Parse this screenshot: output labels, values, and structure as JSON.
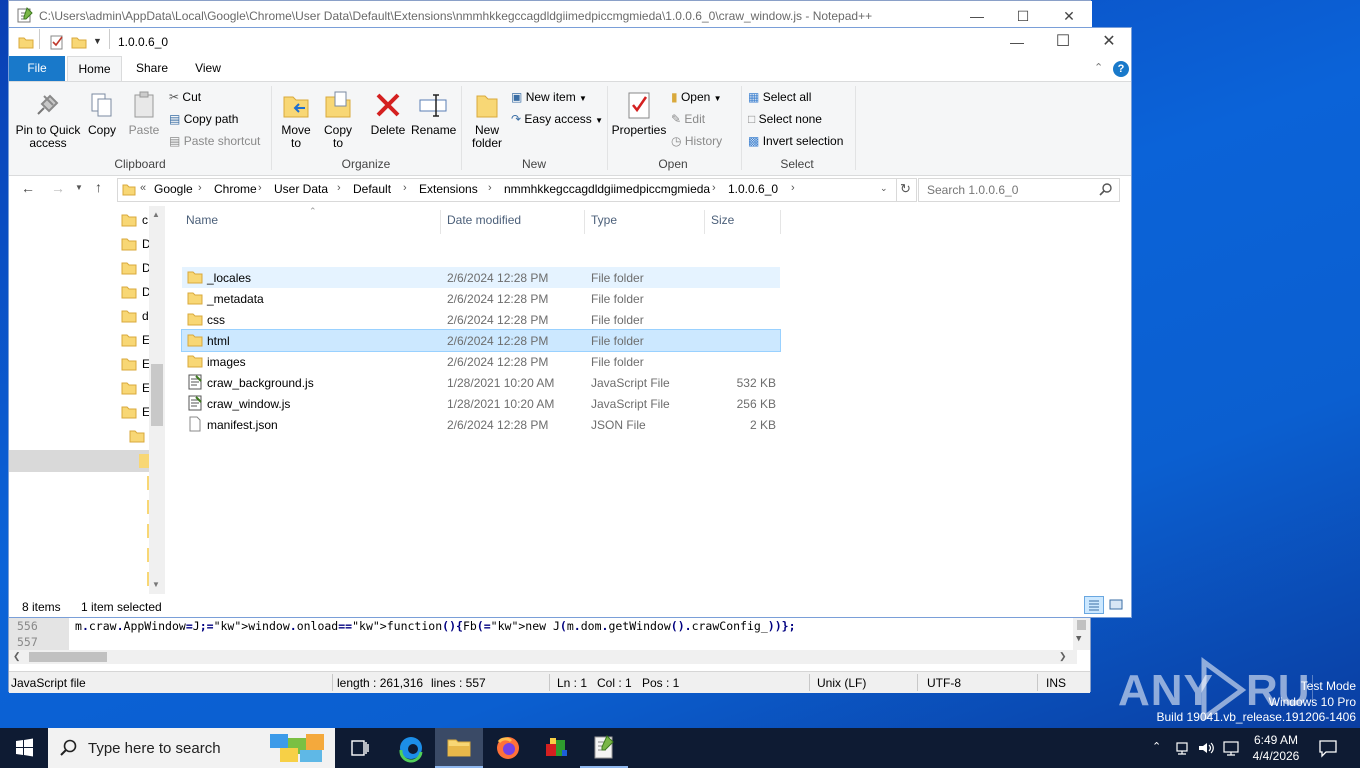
{
  "notepad": {
    "title": "C:\\Users\\admin\\AppData\\Local\\Google\\Chrome\\User Data\\Default\\Extensions\\nmmhkkegccagdldgiimedpiccmgmieda\\1.0.0.6_0\\craw_window.js - Notepad++",
    "line_numbers": [
      "556",
      "557"
    ],
    "code_line": "m.craw.AppWindow=J;window.onload=function(){Fb(new J(m.dom.getWindow().crawConfig_))};",
    "status": {
      "filetype": "JavaScript file",
      "length": "length : 261,316",
      "lines": "lines : 557",
      "ln": "Ln : 1",
      "col": "Col : 1",
      "pos": "Pos : 1",
      "eol": "Unix (LF)",
      "encoding": "UTF-8",
      "mode": "INS"
    }
  },
  "explorer": {
    "title_path": "1.0.0.6_0",
    "tabs": [
      "File",
      "Home",
      "Share",
      "View"
    ],
    "ribbon": {
      "clipboard": {
        "pin": "Pin to Quick access",
        "copy": "Copy",
        "paste": "Paste",
        "cut": "Cut",
        "copy_path": "Copy path",
        "paste_shortcut": "Paste shortcut",
        "label": "Clipboard"
      },
      "organize": {
        "move_to": "Move to",
        "copy_to": "Copy to",
        "delete": "Delete",
        "rename": "Rename",
        "label": "Organize"
      },
      "new": {
        "new_folder": "New folder",
        "new_item": "New item",
        "easy_access": "Easy access",
        "label": "New"
      },
      "open": {
        "properties": "Properties",
        "open": "Open",
        "edit": "Edit",
        "history": "History",
        "label": "Open"
      },
      "select": {
        "select_all": "Select all",
        "select_none": "Select none",
        "invert": "Invert selection",
        "label": "Select"
      }
    },
    "breadcrumb": [
      "Google",
      "Chrome",
      "User Data",
      "Default",
      "Extensions",
      "nmmhkkegccagdldgiimedpiccmgmieda",
      "1.0.0.6_0"
    ],
    "search_placeholder": "Search 1.0.0.6_0",
    "nav_items": [
      "c",
      "D",
      "D",
      "D",
      "d",
      "E",
      "E",
      "E",
      "E"
    ],
    "columns": [
      "Name",
      "Date modified",
      "Type",
      "Size"
    ],
    "files": [
      {
        "name": "_locales",
        "date": "2/6/2024 12:28 PM",
        "type": "File folder",
        "size": "",
        "kind": "folder",
        "state": "hover"
      },
      {
        "name": "_metadata",
        "date": "2/6/2024 12:28 PM",
        "type": "File folder",
        "size": "",
        "kind": "folder",
        "state": ""
      },
      {
        "name": "css",
        "date": "2/6/2024 12:28 PM",
        "type": "File folder",
        "size": "",
        "kind": "folder",
        "state": ""
      },
      {
        "name": "html",
        "date": "2/6/2024 12:28 PM",
        "type": "File folder",
        "size": "",
        "kind": "folder",
        "state": "selected"
      },
      {
        "name": "images",
        "date": "2/6/2024 12:28 PM",
        "type": "File folder",
        "size": "",
        "kind": "folder",
        "state": ""
      },
      {
        "name": "craw_background.js",
        "date": "1/28/2021 10:20 AM",
        "type": "JavaScript File",
        "size": "532 KB",
        "kind": "js",
        "state": ""
      },
      {
        "name": "craw_window.js",
        "date": "1/28/2021 10:20 AM",
        "type": "JavaScript File",
        "size": "256 KB",
        "kind": "js",
        "state": ""
      },
      {
        "name": "manifest.json",
        "date": "2/6/2024 12:28 PM",
        "type": "JSON File",
        "size": "2 KB",
        "kind": "file",
        "state": ""
      }
    ],
    "status": {
      "count": "8 items",
      "selected": "1 item selected"
    }
  },
  "taskbar": {
    "search_placeholder": "Type here to search",
    "time": "6:49 AM",
    "date": "4/4/2026"
  },
  "watermark": {
    "brand": "ANY RUN",
    "line1": "Test Mode",
    "line2": "Windows 10 Pro",
    "line3": "Build 19041.vb_release.191206-1406"
  },
  "colors": {
    "selection": "#cce8ff",
    "hover": "#e5f3ff",
    "file_tab": "#1979ca",
    "taskbar": "#0e1b33"
  }
}
